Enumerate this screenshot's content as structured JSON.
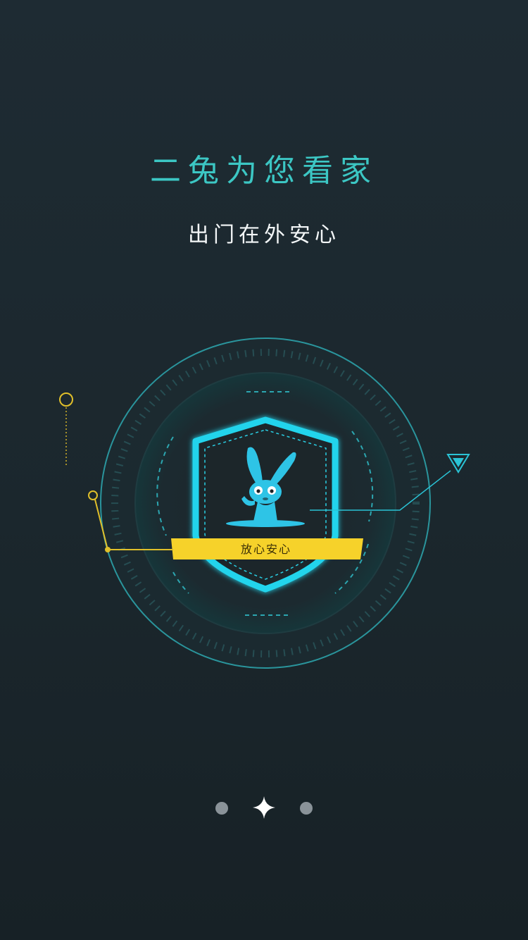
{
  "header": {
    "title": "二兔为您看家",
    "subtitle": "出门在外安心"
  },
  "badge": {
    "label": "放心安心"
  },
  "pager": {
    "count": 3,
    "active_index": 1
  },
  "colors": {
    "accent_teal": "#3cc7c4",
    "shield_cyan": "#22c6e0",
    "badge_yellow": "#f6d22a",
    "background": "#1e2b33",
    "dot_inactive": "#8a9399"
  },
  "icons": {
    "mascot": "rabbit-mascot-icon",
    "shield": "shield-icon",
    "active_page": "star-icon"
  }
}
